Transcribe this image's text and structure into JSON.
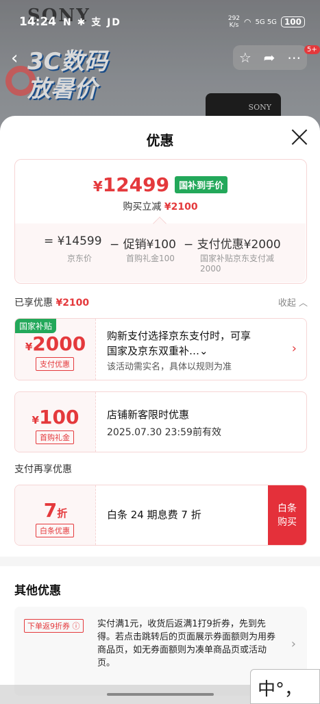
{
  "status": {
    "time": "14:24",
    "left_icons": "N ✱ 支 JD",
    "speed": "292\nK/s",
    "network": "5G 5G",
    "battery": "100"
  },
  "background": {
    "brand": "SONY",
    "promo": "3C数码\n放暑价",
    "camera_brand": "SONY",
    "badge": "5+"
  },
  "sheet": {
    "title": "优惠",
    "summary": {
      "yen": "¥",
      "price": "12499",
      "gov_tag": "国补到手价",
      "reduce_label": "购买立减",
      "reduce_amount": "¥2100",
      "eq1": "= ¥14599",
      "eq1_sub": "京东价",
      "eq2": "− 促销¥100",
      "eq2_sub": "首购礼金100",
      "eq3": "− 支付优惠¥2000",
      "eq3_sub": "国家补贴京东支付减\n2000"
    },
    "enjoyed_label": "已享优惠",
    "enjoyed_amount": "¥2100",
    "collapse": "收起 ︿",
    "card1": {
      "corner": "国家补贴",
      "yen": "¥",
      "amount": "2000",
      "type": "支付优惠",
      "desc": "购新支付选择京东支付时，可享\n国家及京东双重补…⌄",
      "desc2": "该活动需实名，具体以规则为准",
      "chev": "›"
    },
    "card2": {
      "yen": "¥",
      "amount": "100",
      "type": "首购礼金",
      "desc": "店铺新客限时优惠",
      "desc2": "2025.07.30 23:59前有效"
    },
    "pay_more_label": "支付再享优惠",
    "card3": {
      "amount": "7",
      "unit": "折",
      "type": "白条优惠",
      "desc": "白条 24 期息费 7 折",
      "button": "白条\n购买"
    },
    "other_title": "其他优惠",
    "other": {
      "tag": "下单返9折券 ⓘ",
      "text": "实付满1元，收货后返满1打9折券，先到先得。若点击跳转后的页面展示券面额则为用券商品页，如无券面额则为凑单商品页或活动页。",
      "chev": "›"
    }
  },
  "ime": "中°，",
  "colors": {
    "accent": "#e4393c",
    "green": "#23a85a"
  }
}
